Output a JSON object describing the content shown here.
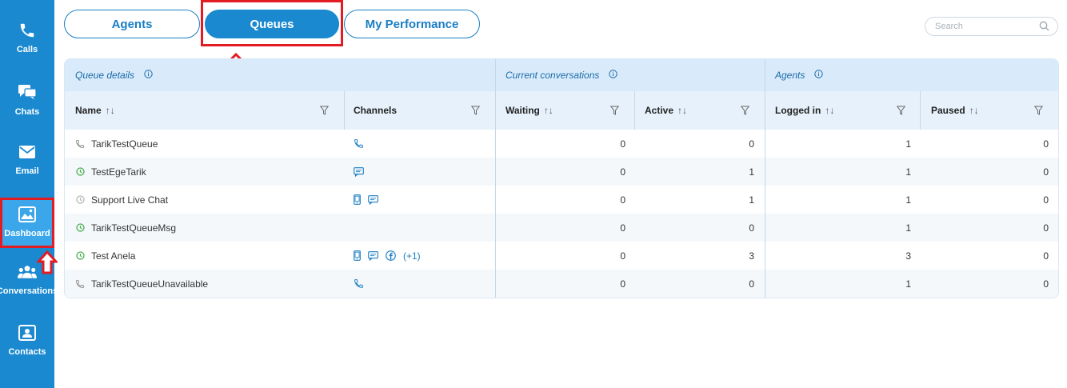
{
  "sidebar": {
    "items": [
      {
        "label": "Calls",
        "icon": "phone-icon"
      },
      {
        "label": "Chats",
        "icon": "chat-icon"
      },
      {
        "label": "Email",
        "icon": "envelope-icon"
      },
      {
        "label": "Dashboard",
        "icon": "dashboard-icon",
        "active": true
      },
      {
        "label": "Conversations",
        "icon": "users-icon"
      },
      {
        "label": "Contacts",
        "icon": "contact-card-icon"
      }
    ]
  },
  "tabs": [
    {
      "label": "Agents"
    },
    {
      "label": "Queues",
      "active": true
    },
    {
      "label": "My Performance"
    }
  ],
  "search": {
    "placeholder": "Search"
  },
  "table": {
    "groups": {
      "queue_details": "Queue details",
      "current_conversations": "Current conversations",
      "agents": "Agents"
    },
    "columns": {
      "name": "Name",
      "channels": "Channels",
      "waiting": "Waiting",
      "active": "Active",
      "logged_in": "Logged in",
      "paused": "Paused"
    },
    "sort_glyph": "↑↓",
    "rows": [
      {
        "status": "phone",
        "name": "TarikTestQueue",
        "channels": [
          "phone"
        ],
        "more": "",
        "waiting": "0",
        "active": "0",
        "logged_in": "1",
        "paused": "0"
      },
      {
        "status": "clock-green",
        "name": "TestEgeTarik",
        "channels": [
          "chat"
        ],
        "more": "",
        "waiting": "0",
        "active": "1",
        "logged_in": "1",
        "paused": "0"
      },
      {
        "status": "clock-grey",
        "name": "Support Live Chat",
        "channels": [
          "mobile",
          "chat"
        ],
        "more": "",
        "waiting": "0",
        "active": "1",
        "logged_in": "1",
        "paused": "0"
      },
      {
        "status": "clock-green",
        "name": "TarikTestQueueMsg",
        "channels": [],
        "more": "",
        "waiting": "0",
        "active": "0",
        "logged_in": "1",
        "paused": "0"
      },
      {
        "status": "clock-green",
        "name": "Test Anela",
        "channels": [
          "mobile",
          "chat",
          "facebook"
        ],
        "more": "(+1)",
        "waiting": "0",
        "active": "3",
        "logged_in": "3",
        "paused": "0"
      },
      {
        "status": "phone",
        "name": "TarikTestQueueUnavailable",
        "channels": [
          "phone"
        ],
        "more": "",
        "waiting": "0",
        "active": "0",
        "logged_in": "1",
        "paused": "0"
      }
    ]
  },
  "colors": {
    "sidebar": "#1a89d0",
    "accent": "#1a7ec4",
    "highlight": "#e31b23",
    "status_green": "#4caf50"
  }
}
